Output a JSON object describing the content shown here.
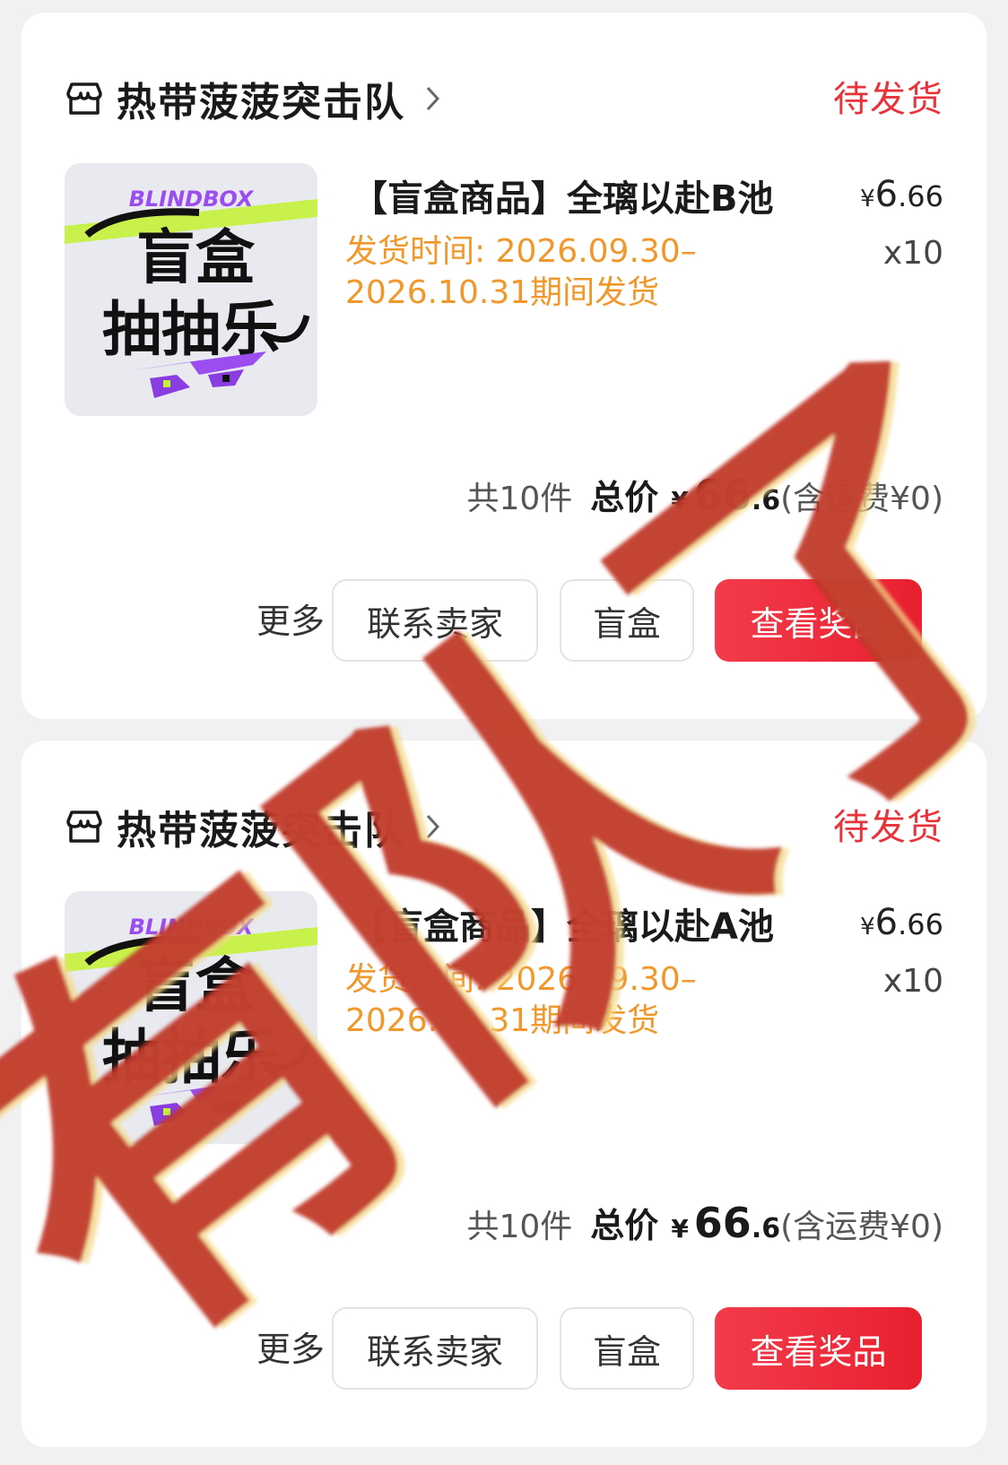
{
  "orders": [
    {
      "shop": {
        "name": "热带菠菠突击队",
        "icon": "shop-icon",
        "chevron_icon": "chevron-right-icon"
      },
      "status": "待发货",
      "thumbnail": {
        "brand": "BLINDBOX",
        "line1": "盲盒",
        "line2": "抽抽乐"
      },
      "product": {
        "name": "【盲盒商品】全璃以赴B池",
        "price_symbol": "¥",
        "price_int": "6",
        "price_dec": ".66",
        "quantity": "x10",
        "ship_time": "发货时间: 2026.09.30–2026.10.31期间发货"
      },
      "summary": {
        "count": "共10件",
        "total_label": "总价",
        "total_symbol": "¥",
        "total_int": "66",
        "total_dec": ".6",
        "shipping": "(含运费¥0)"
      },
      "actions": {
        "more": "更多",
        "contact": "联系卖家",
        "blindbox": "盲盒",
        "view_prize": "查看奖品"
      }
    },
    {
      "shop": {
        "name": "热带菠菠突击队",
        "icon": "shop-icon",
        "chevron_icon": "chevron-right-icon"
      },
      "status": "待发货",
      "thumbnail": {
        "brand": "BLINDBOX",
        "line1": "盲盒",
        "line2": "抽抽乐"
      },
      "product": {
        "name": "【盲盒商品】全璃以赴A池",
        "price_symbol": "¥",
        "price_int": "6",
        "price_dec": ".66",
        "quantity": "x10",
        "ship_time": "发货时间: 2026.09.30–2026.10.31期间发货"
      },
      "summary": {
        "count": "共10件",
        "total_label": "总价",
        "total_symbol": "¥",
        "total_int": "66",
        "total_dec": ".6",
        "shipping": "(含运费¥0)"
      },
      "actions": {
        "more": "更多",
        "contact": "联系卖家",
        "blindbox": "盲盒",
        "view_prize": "查看奖品"
      }
    }
  ],
  "watermark": {
    "text": "有队了"
  },
  "colors": {
    "status": "#e8333b",
    "ship_time": "#f0982b",
    "primary_button": "#f0303f",
    "watermark": "#c0392b"
  }
}
